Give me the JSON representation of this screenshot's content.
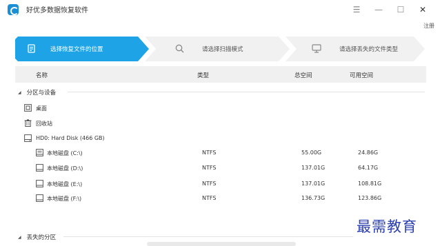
{
  "app": {
    "title": "好优多数据恢复软件"
  },
  "window_controls": {
    "menu": "☰",
    "minimize": "—",
    "maximize": "☐",
    "close": "✕"
  },
  "register_link": "注册",
  "steps": [
    {
      "label": "选择恢复文件的位置",
      "icon": "document-icon",
      "active": true
    },
    {
      "label": "请选择扫描模式",
      "icon": "search-icon",
      "active": false
    },
    {
      "label": "请选择丢失的文件类型",
      "icon": "monitor-icon",
      "active": false
    }
  ],
  "table_header": {
    "name": "名称",
    "type": "类型",
    "total": "总空间",
    "free": "可用空间"
  },
  "sections": {
    "partitions": "分区与设备",
    "lost": "丢失的分区"
  },
  "items": {
    "desktop": "桌面",
    "recycle_bin": "回收站",
    "disk": "HD0: Hard Disk (466 GB)"
  },
  "drives": [
    {
      "name": "本地磁盘 (C:\\)",
      "fs": "NTFS",
      "total": "55.00G",
      "free": "24.86G"
    },
    {
      "name": "本地磁盘 (D:\\)",
      "fs": "NTFS",
      "total": "137.01G",
      "free": "64.17G"
    },
    {
      "name": "本地磁盘 (E:\\)",
      "fs": "NTFS",
      "total": "137.01G",
      "free": "108.81G"
    },
    {
      "name": "本地磁盘 (F:\\)",
      "fs": "NTFS",
      "total": "136.73G",
      "free": "123.86G"
    }
  ],
  "watermark": "最需教育",
  "colors": {
    "accent": "#1ea3e6",
    "step_inactive": "#f1f1f1",
    "watermark": "#2c3fae"
  }
}
